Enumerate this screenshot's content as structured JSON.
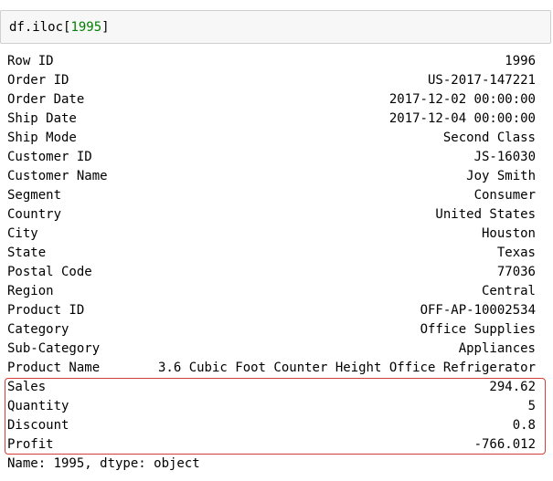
{
  "input": {
    "code_prefix": "df.iloc[",
    "code_index": "1995",
    "code_suffix": "]"
  },
  "output": {
    "rows": [
      {
        "key": "Row ID",
        "value": "1996"
      },
      {
        "key": "Order ID",
        "value": "US-2017-147221"
      },
      {
        "key": "Order Date",
        "value": "2017-12-02 00:00:00"
      },
      {
        "key": "Ship Date",
        "value": "2017-12-04 00:00:00"
      },
      {
        "key": "Ship Mode",
        "value": "Second Class"
      },
      {
        "key": "Customer ID",
        "value": "JS-16030"
      },
      {
        "key": "Customer Name",
        "value": "Joy Smith"
      },
      {
        "key": "Segment",
        "value": "Consumer"
      },
      {
        "key": "Country",
        "value": "United States"
      },
      {
        "key": "City",
        "value": "Houston"
      },
      {
        "key": "State",
        "value": "Texas"
      },
      {
        "key": "Postal Code",
        "value": "77036"
      },
      {
        "key": "Region",
        "value": "Central"
      },
      {
        "key": "Product ID",
        "value": "OFF-AP-10002534"
      },
      {
        "key": "Category",
        "value": "Office Supplies"
      },
      {
        "key": "Sub-Category",
        "value": "Appliances"
      },
      {
        "key": "Product Name",
        "value": "3.6 Cubic Foot Counter Height Office Refrigerator"
      },
      {
        "key": "Sales",
        "value": "294.62"
      },
      {
        "key": "Quantity",
        "value": "5"
      },
      {
        "key": "Discount",
        "value": "0.8"
      },
      {
        "key": "Profit",
        "value": "-766.012"
      }
    ],
    "footer": "Name: 1995, dtype: object"
  },
  "colors": {
    "highlight": "#d93a3a",
    "code_number": "#008000",
    "input_background": "#f7f7f7"
  }
}
